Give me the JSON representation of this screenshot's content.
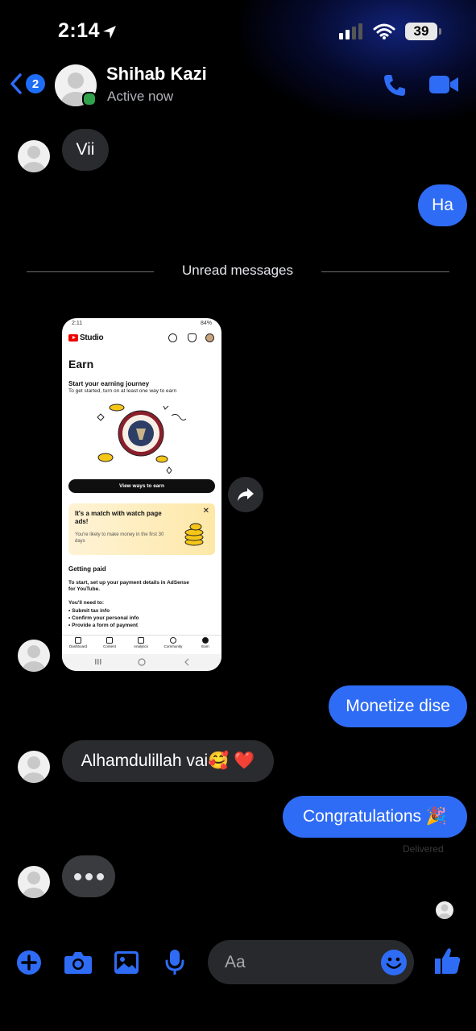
{
  "status_bar": {
    "time": "2:14",
    "battery": "39"
  },
  "header": {
    "back_badge": "2",
    "contact_name": "Shihab Kazi",
    "contact_status": "Active now"
  },
  "conversation": {
    "msg_vii": "Vii",
    "msg_ha": "Ha",
    "unread_divider": "Unread messages",
    "msg_monetize": "Monetize dise",
    "msg_alhamdulillah": "Alhamdulillah vai🥰 ❤️",
    "msg_congrats": "Congratulations 🎉",
    "delivered": "Delivered"
  },
  "shared_screenshot": {
    "status_time": "2:11",
    "status_battery": "84%",
    "app_name": "Studio",
    "page_title": "Earn",
    "heading": "Start your earning journey",
    "subheading": "To get started, turn on at least one way to earn",
    "button": "View ways to earn",
    "card_title": "It's a match with watch page ads!",
    "card_text": "You're likely to make money in the first 30 days",
    "paid_title": "Getting paid",
    "paid_text": "To start, set up your payment details in AdSense for YouTube.",
    "need_title": "You'll need to:",
    "needs": [
      "Submit tax info",
      "Confirm your personal info",
      "Provide a form of payment"
    ],
    "nav": [
      "Dashboard",
      "Content",
      "Analytics",
      "Community",
      "Earn"
    ]
  },
  "composer": {
    "placeholder": "Aa"
  },
  "colors": {
    "accent": "#2f6cf5",
    "incoming_bubble": "#2a2b2f",
    "online": "#31a24c"
  }
}
